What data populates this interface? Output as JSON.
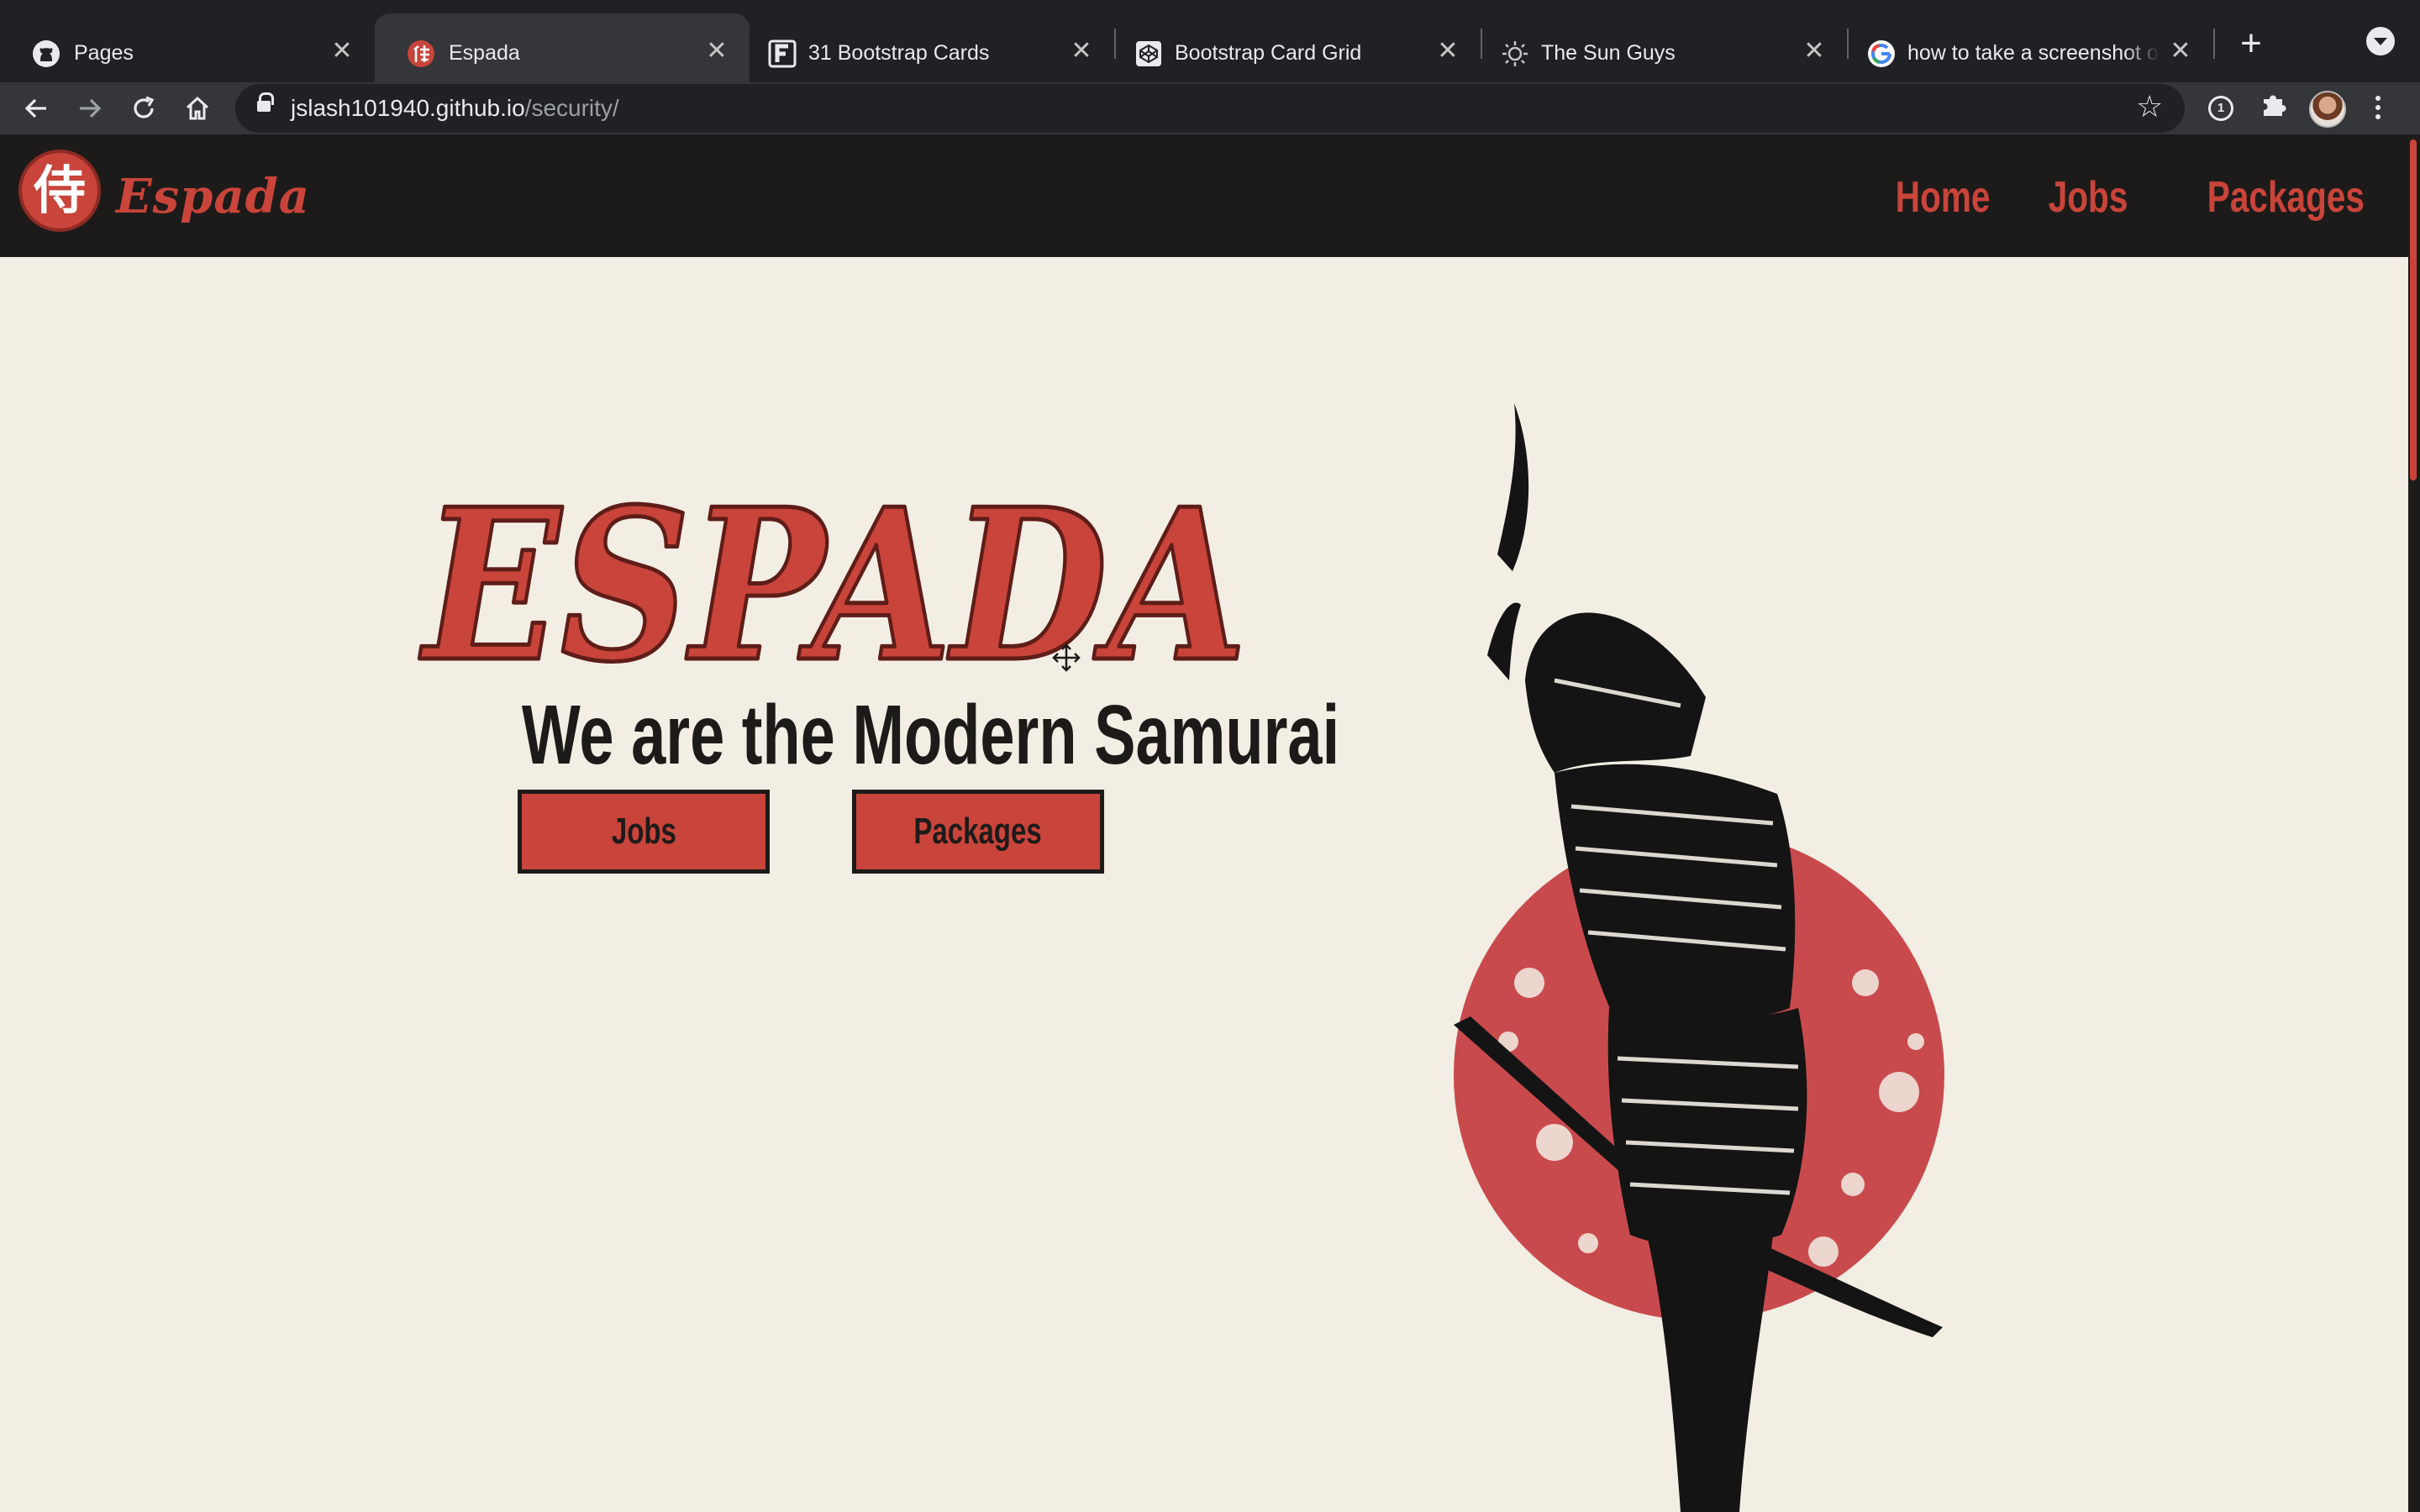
{
  "browser": {
    "tabs": [
      {
        "title": "Pages",
        "icon": "github-icon",
        "active": false
      },
      {
        "title": "Espada",
        "icon": "samurai-kanji-icon",
        "active": true
      },
      {
        "title": "31 Bootstrap Cards",
        "icon": "f-logo-icon",
        "active": false
      },
      {
        "title": "Bootstrap Card Grid",
        "icon": "codepen-icon",
        "active": false
      },
      {
        "title": "The Sun Guys",
        "icon": "sun-icon",
        "active": false
      },
      {
        "title": "how to take a screenshot o",
        "icon": "google-icon",
        "active": false
      }
    ],
    "close_glyph": "✕",
    "new_tab_glyph": "+",
    "url_host": "jslash101940.github.io",
    "url_path": "/security/",
    "extension_badge": "1"
  },
  "site": {
    "brand": "Espada",
    "brand_kanji": "侍",
    "nav": {
      "home": "Home",
      "jobs": "Jobs",
      "packages": "Packages"
    },
    "hero": {
      "title": "ESPADA",
      "subtitle": "We are the Modern Samurai",
      "buttons": {
        "jobs": "Jobs",
        "packages": "Packages"
      }
    }
  },
  "colors": {
    "accent": "#c9443a",
    "dark": "#1d1b1a",
    "page_bg": "#f3eee4"
  }
}
